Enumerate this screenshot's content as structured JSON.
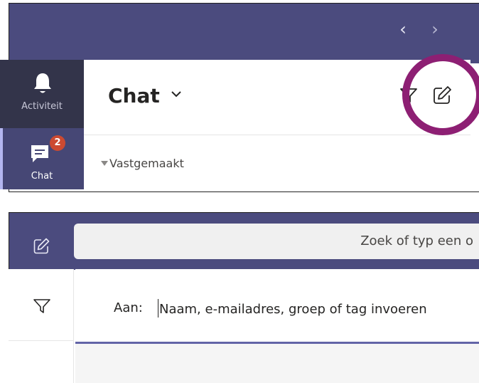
{
  "panel1": {
    "nav": {
      "back": "‹",
      "forward": "›"
    },
    "rail": {
      "activity": {
        "label": "Activiteit",
        "icon": "bell-icon"
      },
      "chat": {
        "label": "Chat",
        "icon": "chat-bubble-icon",
        "badge": "2"
      }
    },
    "header": {
      "title": "Chat",
      "filter_icon": "filter-icon",
      "compose_icon": "compose-icon"
    },
    "pinned": {
      "label": "Vastgemaakt"
    },
    "highlight_color": "#8d1f73"
  },
  "panel2": {
    "search": {
      "text": "Zoek of typ een o"
    },
    "to": {
      "label": "Aan:",
      "placeholder": "Naam, e-mailadres, groep of tag invoeren"
    }
  },
  "colors": {
    "top_bar": "#4b4b7e",
    "rail": "#33344a",
    "rail_active": "#464775",
    "accent": "#6264a7",
    "badge": "#cc4a31"
  }
}
